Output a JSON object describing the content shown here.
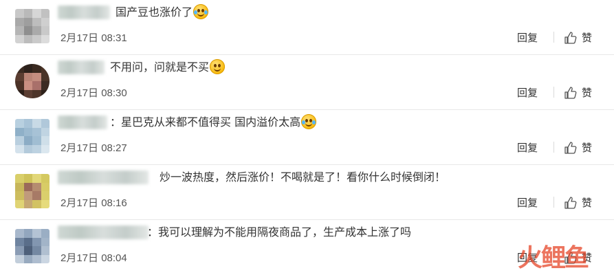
{
  "comments": [
    {
      "text": "国产豆也涨价了",
      "emoji": "laugh-cry-emoji",
      "date": "2月17日 08:31",
      "reply": "回复",
      "like": "赞"
    },
    {
      "text": "不用问，问就是不买",
      "emoji": "smile-emoji",
      "date": "2月17日 08:30",
      "reply": "回复",
      "like": "赞"
    },
    {
      "text": "：星巴克从来都不值得买 国内溢价太高",
      "emoji": "laugh-cry-emoji",
      "date": "2月17日 08:27",
      "reply": "回复",
      "like": "赞"
    },
    {
      "text": "炒一波热度，然后涨价！不喝就是了！看你什么时候倒闭！",
      "emoji": "",
      "date": "2月17日 08:16",
      "reply": "回复",
      "like": "赞"
    },
    {
      "text": "：我可以理解为不能用隔夜商品了，生产成本上涨了吗",
      "emoji": "",
      "date": "2月17日 08:04",
      "reply": "回复",
      "like": "赞"
    }
  ],
  "watermark": "火鲤鱼",
  "colors": {
    "text": "#333333",
    "date": "#555555",
    "divider": "#e8e8e8",
    "watermark": "#e64628"
  }
}
